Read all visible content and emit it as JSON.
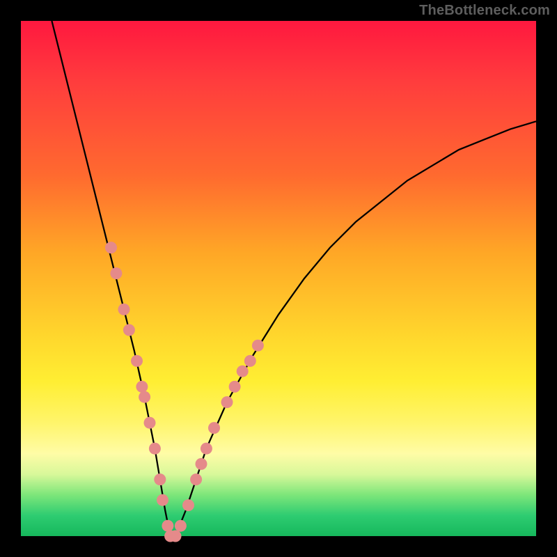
{
  "watermark": "TheBottleneck.com",
  "chart_data": {
    "type": "line",
    "title": "",
    "xlabel": "",
    "ylabel": "",
    "xlim": [
      0,
      100
    ],
    "ylim": [
      0,
      100
    ],
    "series": [
      {
        "name": "bottleneck-curve",
        "x": [
          6,
          8,
          10,
          12,
          14,
          16,
          18,
          20,
          22,
          24,
          26,
          27,
          28,
          29,
          30,
          32,
          34,
          36,
          40,
          45,
          50,
          55,
          60,
          65,
          70,
          75,
          80,
          85,
          90,
          95,
          100
        ],
        "y": [
          100,
          92,
          84,
          76,
          68,
          60,
          52,
          44,
          36,
          27,
          17,
          11,
          5,
          0,
          0,
          5,
          11,
          17,
          26,
          35,
          43,
          50,
          56,
          61,
          65,
          69,
          72,
          75,
          77,
          79,
          80.5
        ]
      }
    ],
    "markers": [
      {
        "x": 17.5,
        "y": 56
      },
      {
        "x": 18.5,
        "y": 51
      },
      {
        "x": 20.0,
        "y": 44
      },
      {
        "x": 21.0,
        "y": 40
      },
      {
        "x": 22.5,
        "y": 34
      },
      {
        "x": 23.5,
        "y": 29
      },
      {
        "x": 24.0,
        "y": 27
      },
      {
        "x": 25.0,
        "y": 22
      },
      {
        "x": 26.0,
        "y": 17
      },
      {
        "x": 27.0,
        "y": 11
      },
      {
        "x": 27.5,
        "y": 7
      },
      {
        "x": 28.5,
        "y": 2
      },
      {
        "x": 29.0,
        "y": 0
      },
      {
        "x": 30.0,
        "y": 0
      },
      {
        "x": 31.0,
        "y": 2
      },
      {
        "x": 32.5,
        "y": 6
      },
      {
        "x": 34.0,
        "y": 11
      },
      {
        "x": 35.0,
        "y": 14
      },
      {
        "x": 36.0,
        "y": 17
      },
      {
        "x": 37.5,
        "y": 21
      },
      {
        "x": 40.0,
        "y": 26
      },
      {
        "x": 41.5,
        "y": 29
      },
      {
        "x": 43.0,
        "y": 32
      },
      {
        "x": 44.5,
        "y": 34
      },
      {
        "x": 46.0,
        "y": 37
      }
    ],
    "marker_color": "#e58a8a",
    "curve_color": "#000000"
  }
}
